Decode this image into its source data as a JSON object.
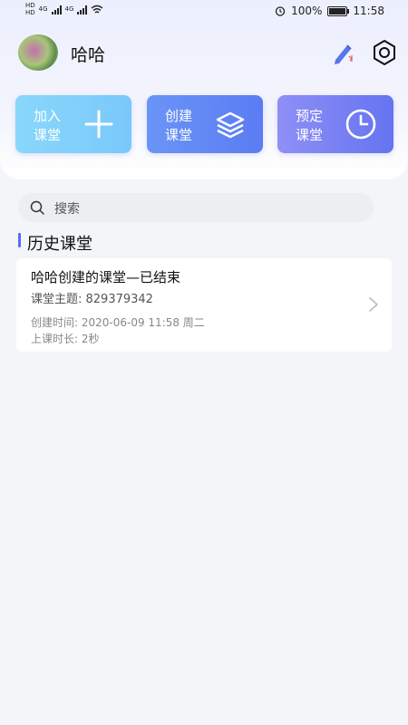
{
  "status_bar": {
    "left_badges": [
      "HD",
      "HD"
    ],
    "network": [
      "4G",
      "4G"
    ],
    "battery_percent": "100%",
    "battery_level": 1.0,
    "time": "11:58",
    "icons": [
      "signal-icon",
      "wifi-icon",
      "alarm-icon",
      "battery-icon"
    ]
  },
  "profile": {
    "username": "哈哈",
    "edit_icon": "pen-icon",
    "settings_icon": "gear-icon"
  },
  "actions": [
    {
      "label": "加入课堂",
      "line1": "加入",
      "line2": "课堂",
      "icon": "plus-icon",
      "color": "#81cffb"
    },
    {
      "label": "创建课堂",
      "line1": "创建",
      "line2": "课堂",
      "icon": "layers-icon",
      "color": "#6388f5"
    },
    {
      "label": "预定课堂",
      "line1": "预定",
      "line2": "课堂",
      "icon": "clock-icon",
      "color": "#7a82f3"
    }
  ],
  "search": {
    "placeholder": "搜索",
    "icon": "search-icon"
  },
  "history": {
    "title": "历史课堂",
    "accent": "#5b6cf0",
    "items": [
      {
        "title": "哈哈创建的课堂—已结束",
        "topic": "课堂主题: 829379342",
        "created": "创建时间: 2020-06-09 11:58 周二",
        "duration": "上课时长: 2秒"
      }
    ]
  }
}
